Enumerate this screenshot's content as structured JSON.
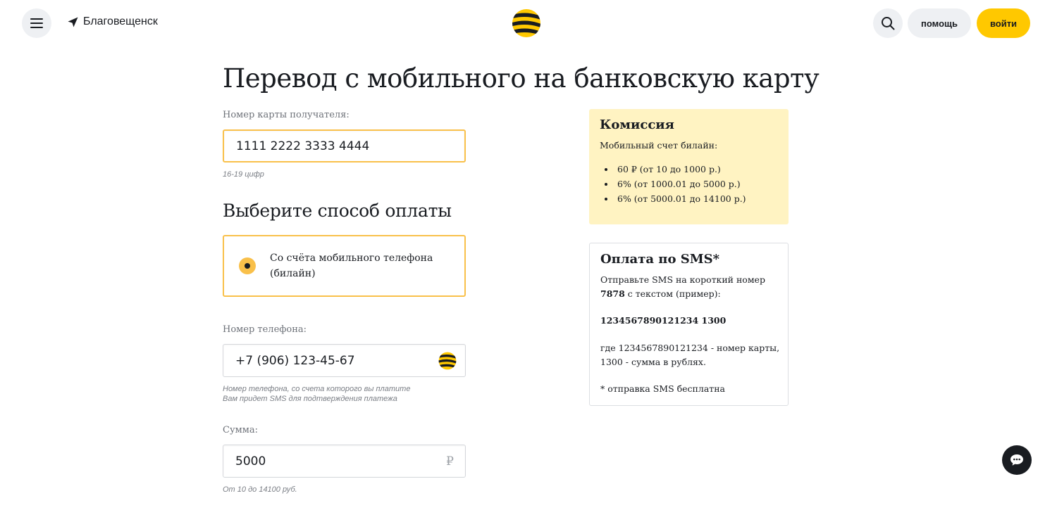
{
  "header": {
    "city": "Благовещенск",
    "help_label": "помощь",
    "login_label": "войти"
  },
  "page": {
    "title": "Перевод с мобильного на банковскую карту"
  },
  "card_field": {
    "label": "Номер карты получателя:",
    "value": "1111 2222 3333 4444",
    "hint": "16-19 цифр"
  },
  "payment": {
    "section_title": "Выберите способ оплаты",
    "option_label": "Со счёта мобильного телефона (билайн)",
    "option_selected": true
  },
  "phone_field": {
    "label": "Номер телефона:",
    "value": "+7 (906) 123-45-67",
    "hint_line1": "Номер телефона, со счета которого вы платите",
    "hint_line2": "Вам придет SMS для подтверждения платежа"
  },
  "amount_field": {
    "label": "Сумма:",
    "value": "5000",
    "currency": "₽",
    "hint": "От 10 до 14100 руб."
  },
  "commission": {
    "title": "Комиссия",
    "subtitle": "Мобильный счет билайн:",
    "items": [
      "60 ₽ (от 10 до 1000 р.)",
      "6% (от 1000.01 до 5000 р.)",
      "6% (от 5000.01 до 14100 р.)"
    ]
  },
  "sms": {
    "title": "Оплата по SMS*",
    "text_before": "Отправьте SMS на короткий номер ",
    "short_number": "7878",
    "text_after": " с текстом (пример):",
    "example": "1234567890121234 1300",
    "explanation": "где 1234567890121234 - номер карты, 1300 - сумма в рублях.",
    "footnote": "* отправка SMS бесплатна"
  },
  "colors": {
    "brand_yellow": "#ffc800",
    "accent_border": "#f9c04a",
    "commission_bg": "#fff3c2",
    "text": "#191c21"
  },
  "icons": {
    "menu": "menu-icon",
    "location": "location-arrow-icon",
    "logo": "beeline-logo",
    "search": "search-icon",
    "chat": "chat-icon",
    "operator": "beeline-operator-icon"
  }
}
